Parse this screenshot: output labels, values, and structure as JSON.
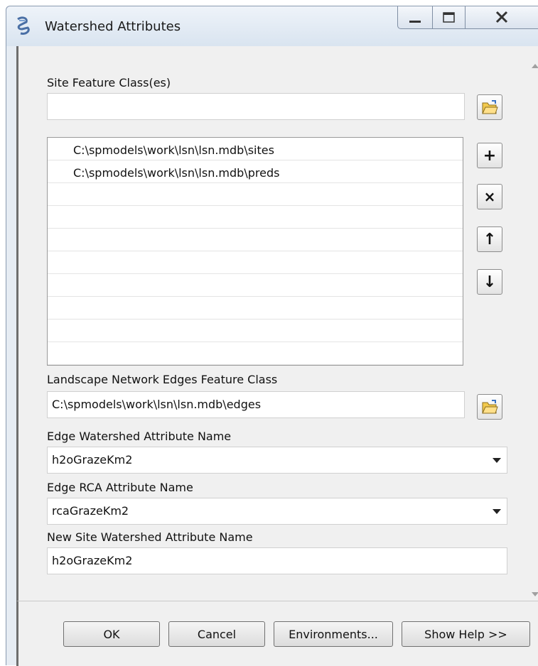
{
  "window": {
    "title": "Watershed Attributes"
  },
  "site_fc": {
    "label": "Site Feature Class(es)",
    "value": ""
  },
  "site_list": [
    "C:\\spmodels\\work\\lsn\\lsn.mdb\\sites",
    "C:\\spmodels\\work\\lsn\\lsn.mdb\\preds"
  ],
  "edges_fc": {
    "label": "Landscape Network Edges Feature Class",
    "value": "C:\\spmodels\\work\\lsn\\lsn.mdb\\edges"
  },
  "edge_watershed": {
    "label": "Edge Watershed Attribute Name",
    "value": "h2oGrazeKm2"
  },
  "edge_rca": {
    "label": "Edge RCA Attribute Name",
    "value": "rcaGrazeKm2"
  },
  "new_site_watershed": {
    "label": "New Site Watershed Attribute Name",
    "value": "h2oGrazeKm2"
  },
  "list_buttons": {
    "add": "+",
    "remove": "×",
    "up": "↑",
    "down": "↓"
  },
  "buttons": {
    "ok": "OK",
    "cancel": "Cancel",
    "environments": "Environments...",
    "help": "Show Help >>"
  },
  "icons": {
    "app": "python-script-icon",
    "browse": "open-folder-icon"
  },
  "colors": {
    "folder": "#f2c94c",
    "window_chrome": "#dbe3ee"
  }
}
